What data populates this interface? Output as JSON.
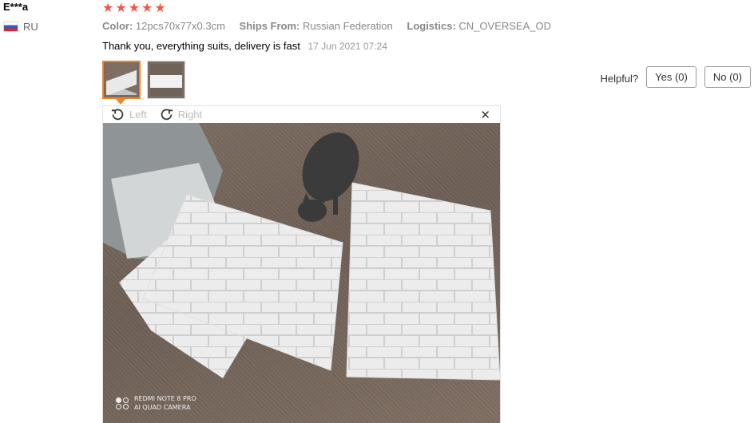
{
  "review": {
    "user": "E***a",
    "country": "RU",
    "stars": [
      "★",
      "★",
      "★",
      "★",
      "★"
    ],
    "rating": 5,
    "color_label": "Color:",
    "color_value": "12pcs70x77x0.3cm",
    "ships_from_label": "Ships From:",
    "ships_from_value": "Russian Federation",
    "logistics_label": "Logistics:",
    "logistics_value": "CN_OVERSEA_OD",
    "text": "Thank you, everything suits, delivery is fast",
    "date": "17 Jun 2021 07:24"
  },
  "helpful": {
    "label": "Helpful?",
    "yes": "Yes (0)",
    "no": "No (0)"
  },
  "viewer": {
    "rotate_left": "Left",
    "rotate_right": "Right",
    "close": "✕",
    "watermark_line1": "REDMI NOTE 8 PRO",
    "watermark_line2": "AI QUAD CAMERA"
  },
  "colors": {
    "star": "#f1584b",
    "thumb_active_border": "#f08427",
    "muted_text": "#999999"
  }
}
